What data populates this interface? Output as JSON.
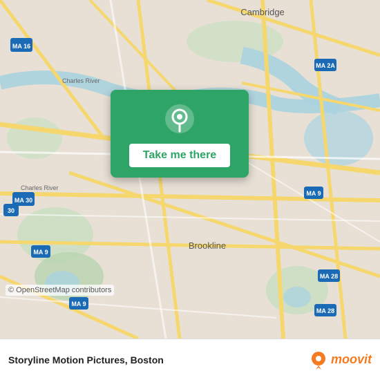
{
  "map": {
    "attribution": "© OpenStreetMap contributors",
    "overlay": {
      "button_label": "Take me there",
      "pin_icon": "map-pin"
    }
  },
  "bottom_bar": {
    "title": "Storyline Motion Pictures, Boston",
    "logo_text": "moovit"
  }
}
